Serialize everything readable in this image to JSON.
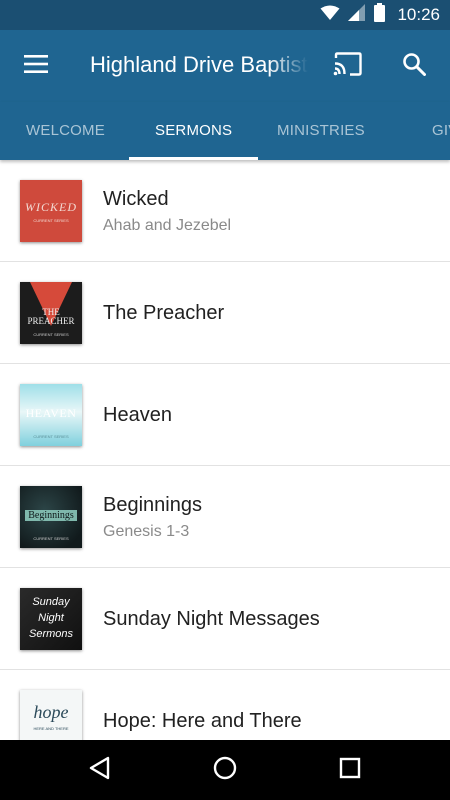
{
  "status_bar": {
    "time": "10:26",
    "icons": [
      "wifi-icon",
      "signal-icon",
      "battery-icon"
    ]
  },
  "app_bar": {
    "title": "Highland Drive Baptist Church",
    "icons": [
      "menu-icon",
      "cast-icon",
      "search-icon"
    ]
  },
  "tabs": [
    {
      "label": "WELCOME",
      "active": false
    },
    {
      "label": "SERMONS",
      "active": true
    },
    {
      "label": "MINISTRIES",
      "active": false
    },
    {
      "label": "GIVE",
      "active": false
    }
  ],
  "sermons": [
    {
      "title": "Wicked",
      "subtitle": "Ahab and Jezebel",
      "art_text": "WICKED",
      "art_caption": "CURRENT SERIES"
    },
    {
      "title": "The Preacher",
      "subtitle": "",
      "art_text": "THE PREACHER",
      "art_caption": "CURRENT SERIES"
    },
    {
      "title": "Heaven",
      "subtitle": "",
      "art_text": "HEAVEN",
      "art_caption": "CURRENT SERIES"
    },
    {
      "title": "Beginnings",
      "subtitle": "Genesis 1-3",
      "art_text": "Beginnings",
      "art_caption": "CURRENT SERIES"
    },
    {
      "title": "Sunday Night Messages",
      "subtitle": "",
      "art_text": "Sunday Night Sermons",
      "art_caption": ""
    },
    {
      "title": "Hope: Here and There",
      "subtitle": "",
      "art_text": "hope",
      "art_caption": "HERE AND THERE"
    }
  ],
  "nav_bar": {
    "icons": [
      "back-icon",
      "home-icon",
      "recents-icon"
    ]
  },
  "colors": {
    "status_bar": "#1b4f72",
    "app_bar": "#1f6591",
    "title_text": "#212121",
    "subtitle_text": "#8a8a8a"
  }
}
